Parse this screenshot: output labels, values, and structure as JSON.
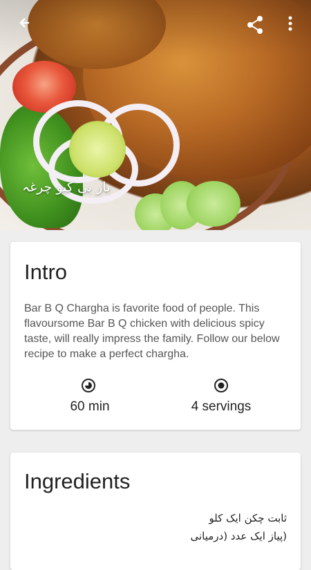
{
  "hero": {
    "title_urdu": "بار بی کیو چرغہ",
    "back_icon": "back-arrow-icon",
    "share_icon": "share-icon",
    "more_icon": "more-vert-icon"
  },
  "intro": {
    "heading": "Intro",
    "description": "Bar B Q Chargha is favorite food of people. This flavoursome Bar B Q chicken with delicious spicy taste, will really impress the family. Follow our below recipe to make a perfect chargha.",
    "time": "60 min",
    "time_icon": "clock-icon",
    "servings": "4 servings",
    "servings_icon": "servings-icon"
  },
  "ingredients": {
    "heading": "Ingredients",
    "lines": [
      "ثابت چکن ایک کلو",
      "(پیاز ایک عدد (درمیانی"
    ]
  }
}
